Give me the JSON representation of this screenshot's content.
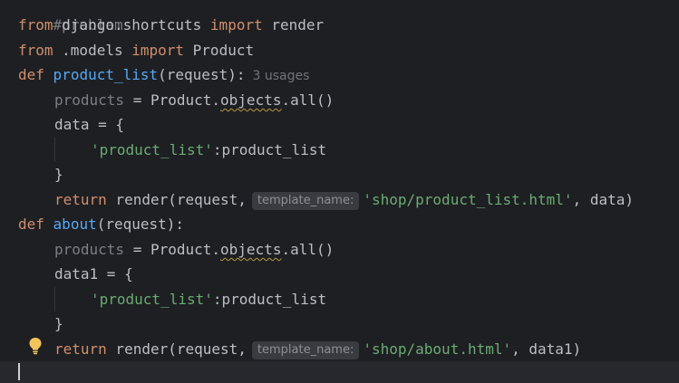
{
  "code": {
    "line0_comment": "#problam",
    "line1": {
      "from": "from",
      "module": " django.shortcuts ",
      "import": "import",
      "name": " render"
    },
    "line2": {
      "from": "from",
      "module": " .models ",
      "import": "import",
      "name": " Product"
    },
    "line3": {
      "def": "def",
      "fname": "product_list",
      "params": "(request):",
      "usages": "3 usages"
    },
    "line4": {
      "lhs": "products",
      "eq": " = Product.",
      "attr": "objects",
      "tail": ".all()"
    },
    "line5": "data = {",
    "line6": {
      "key": "'product_list'",
      "value": ":product_list"
    },
    "line7": "}",
    "line8": {
      "ret": "return",
      "call": " render(request,",
      "hint": "template_name:",
      "str": "'shop/product_list.html'",
      "tail": ", data)"
    },
    "line9": {
      "def": "def",
      "fname": "about",
      "params": "(request):"
    },
    "line10": {
      "lhs": "products",
      "eq": " = Product.",
      "attr": "objects",
      "tail": ".all()"
    },
    "line11": "data1 = {",
    "line12": {
      "key": "'product_list'",
      "value": ":product_list"
    },
    "line13": "}",
    "line14": {
      "ret": "return",
      "call": " render(request,",
      "hint": "template_name:",
      "str": "'shop/about.html'",
      "tail": ", data1)"
    }
  },
  "icons": {
    "intention": "lightbulb-icon"
  },
  "colors": {
    "background": "#1e1f22",
    "keyword": "#cf8e6d",
    "function": "#56a8f5",
    "string": "#6aab73",
    "text": "#bcbec4",
    "bulb": "#f2c55c"
  }
}
